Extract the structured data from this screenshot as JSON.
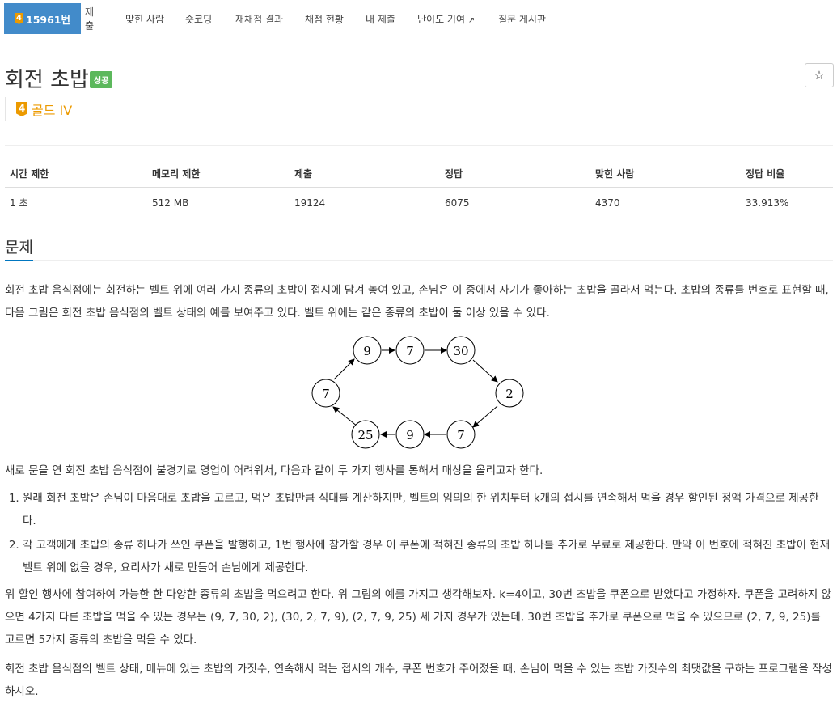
{
  "nav": {
    "problem_number": "15961번",
    "tier_digit": "4",
    "items": [
      "제출",
      "맞힌 사람",
      "숏코딩",
      "재채점 결과",
      "채점 현황",
      "내 제출",
      "난이도 기여",
      "질문 게시판"
    ]
  },
  "problem": {
    "title": "회전 초밥",
    "status_badge": "성공",
    "star": "☆",
    "tier_label": "골드 IV",
    "tier_digit": "4"
  },
  "info_table": {
    "headers": [
      "시간 제한",
      "메모리 제한",
      "제출",
      "정답",
      "맞힌 사람",
      "정답 비율"
    ],
    "values": [
      "1 초",
      "512 MB",
      "19124",
      "6075",
      "4370",
      "33.913%"
    ]
  },
  "section": {
    "title": "문제"
  },
  "diagram": {
    "nodes": [
      "9",
      "7",
      "30",
      "2",
      "7",
      "9",
      "25",
      "7"
    ]
  },
  "text": {
    "p1": "회전 초밥 음식점에는 회전하는 벨트 위에 여러 가지 종류의 초밥이 접시에 담겨 놓여 있고, 손님은 이 중에서 자기가 좋아하는 초밥을 골라서 먹는다. 초밥의 종류를 번호로 표현할 때, 다음 그림은 회전 초밥 음식점의 벨트 상태의 예를 보여주고 있다. 벨트 위에는 같은 종류의 초밥이 둘 이상 있을 수 있다.",
    "p2": "새로 문을 연 회전 초밥 음식점이 불경기로 영업이 어려워서, 다음과 같이 두 가지 행사를 통해서 매상을 올리고자 한다.",
    "li1": "원래 회전 초밥은 손님이 마음대로 초밥을 고르고, 먹은 초밥만큼 식대를 계산하지만, 벨트의 임의의 한 위치부터 k개의 접시를 연속해서 먹을 경우 할인된 정액 가격으로 제공한다.",
    "li2": "각 고객에게 초밥의 종류 하나가 쓰인 쿠폰을 발행하고, 1번 행사에 참가할 경우 이 쿠폰에 적혀진 종류의 초밥 하나를 추가로 무료로 제공한다. 만약 이 번호에 적혀진 초밥이 현재 벨트 위에 없을 경우, 요리사가 새로 만들어 손님에게 제공한다.",
    "p3": "위 할인 행사에 참여하여 가능한 한 다양한 종류의 초밥을 먹으려고 한다. 위 그림의 예를 가지고 생각해보자. k=4이고, 30번 초밥을 쿠폰으로 받았다고 가정하자. 쿠폰을 고려하지 않으면 4가지 다른 초밥을 먹을 수 있는 경우는 (9, 7, 30, 2), (30, 2, 7, 9), (2, 7, 9, 25) 세 가지 경우가 있는데, 30번 초밥을 추가로 쿠폰으로 먹을 수 있으므로 (2, 7, 9, 25)를 고르면 5가지 종류의 초밥을 먹을 수 있다.",
    "p4": "회전 초밥 음식점의 벨트 상태, 메뉴에 있는 초밥의 가짓수, 연속해서 먹는 접시의 개수, 쿠폰 번호가 주어졌을 때, 손님이 먹을 수 있는 초밥 가짓수의 최댓값을 구하는 프로그램을 작성하시오."
  }
}
